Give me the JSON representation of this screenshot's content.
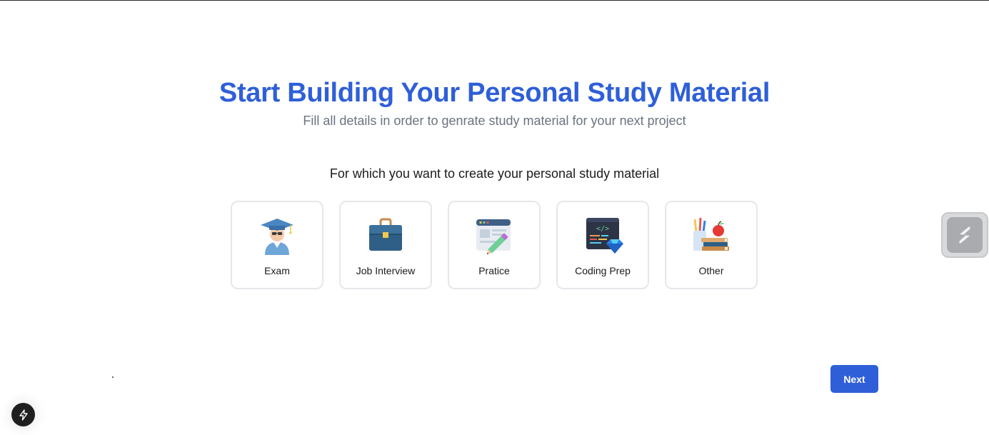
{
  "header": {
    "title": "Start Building Your Personal Study Material",
    "subtitle": "Fill all details in order to genrate study material for your next project"
  },
  "question": "For which you want to create your personal study material",
  "options": [
    {
      "label": "Exam",
      "icon": "graduate-icon"
    },
    {
      "label": "Job Interview",
      "icon": "briefcase-icon"
    },
    {
      "label": "Pratice",
      "icon": "practice-board-icon"
    },
    {
      "label": "Coding Prep",
      "icon": "code-screen-icon"
    },
    {
      "label": "Other",
      "icon": "books-icon"
    }
  ],
  "actions": {
    "next_label": "Next"
  },
  "colors": {
    "accent": "#2f5fd8",
    "subtitle": "#6b7380",
    "card_border": "#e5e7eb"
  }
}
